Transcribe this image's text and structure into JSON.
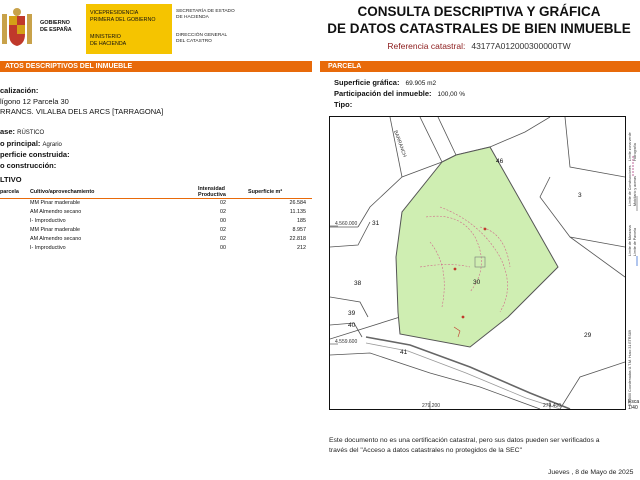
{
  "header": {
    "gov_lines": [
      "GOBIERNO",
      "DE ESPAÑA"
    ],
    "ministry_top_lines": [
      "VICEPRESIDENCIA",
      "PRIMERA DEL GOBIERNO"
    ],
    "ministry_bottom_lines": [
      "MINISTERIO",
      "DE HACIENDA"
    ],
    "secretariat_lines": [
      "SECRETARÍA DE ESTADO",
      "DE HACIENDA"
    ],
    "directorate_lines": [
      "DIRECCIÓN GENERAL",
      "DEL CATASTRO"
    ],
    "title_line1": "CONSULTA DESCRIPTIVA Y GRÁFICA",
    "title_line2": "DE DATOS CATASTRALES DE BIEN INMUEBLE",
    "ref_label": "Referencia catastral:",
    "ref_value": "43177A012000300000TW"
  },
  "left": {
    "section_title": "ATOS DESCRIPTIVOS DEL INMUEBLE",
    "location_label": "calización:",
    "location_line1": "lígono 12 Parcela 30",
    "location_line2": "RRANCS. VILALBA DELS ARCS [TARRAGONA]",
    "class_label": "ase:",
    "class_value": "RÚSTICO",
    "use_label": "o principal:",
    "use_value": "Agrario",
    "built_label": "perficie construida:",
    "year_label": "o construcción:",
    "cultivo_label": "LTIVO",
    "table_headers": [
      "parcela",
      "Cultivo/aprovechamiento",
      "Intensidad Productiva",
      "Superficie m²"
    ],
    "rows": [
      {
        "cult": "MM Pinar maderable",
        "int": "02",
        "sup": "26.584"
      },
      {
        "cult": "AM Almendro secano",
        "int": "02",
        "sup": "11.135"
      },
      {
        "cult": "I- Improductivo",
        "int": "00",
        "sup": "185"
      },
      {
        "cult": "MM Pinar maderable",
        "int": "02",
        "sup": "8.957"
      },
      {
        "cult": "AM Almendro secano",
        "int": "02",
        "sup": "22.818"
      },
      {
        "cult": "I- Improductivo",
        "int": "00",
        "sup": "212"
      }
    ]
  },
  "right": {
    "section_title": "PARCELA",
    "surface_label": "Superficie gráfica:",
    "surface_value": "69.905 m2",
    "participation_label": "Participación del inmueble:",
    "participation_value": "100,00 %",
    "type_label": "Tipo:"
  },
  "map": {
    "parcel_labels": [
      "46",
      "3",
      "31",
      "38",
      "39",
      "40",
      "30",
      "41",
      "29"
    ],
    "street_label": "BARRANCH",
    "y_coord_1": "4.560.000",
    "y_coord_2": "4.559.600",
    "x_coord_1": "279.200",
    "x_coord_2": "279.400",
    "legend_lines": [
      "Límite de Manzana",
      "Límite de Parcela",
      "Límite de Construcciones",
      "Mobiliario y aceras",
      "Límite zona verde",
      "Hidrografía"
    ],
    "projection": "279,600 Coordenadas U.T.M. Huso 31 ETRS89",
    "scale_label": "Esca",
    "scale_value": "1/40",
    "parcel_fill": "#cfeeb2"
  },
  "footer": {
    "notice_line1": "Este documento no es una certificación catastral, pero sus datos pueden ser verificados a",
    "notice_line2": "través del \"Acceso a datos catastrales no protegidos de la SEC\"",
    "date": "Jueves , 8 de Mayo de 2025"
  }
}
